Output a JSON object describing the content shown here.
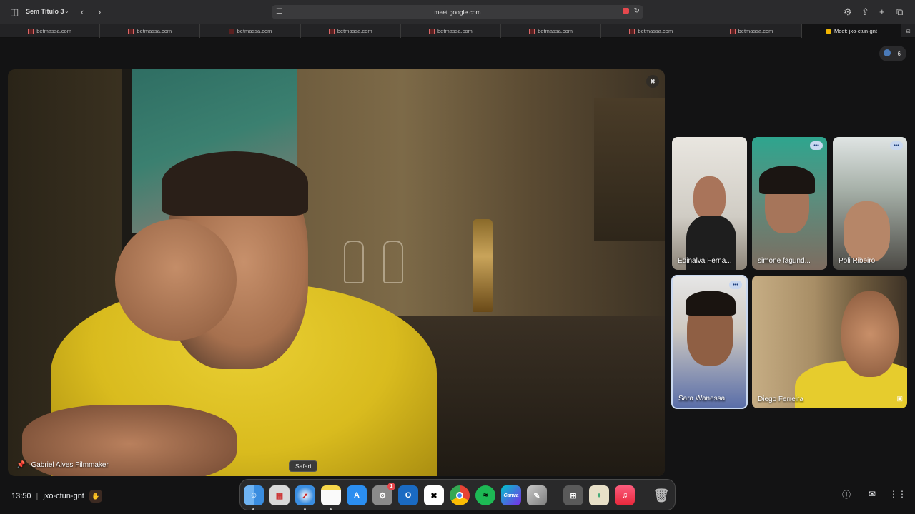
{
  "browser": {
    "window_title": "Sem Título 3",
    "url": "meet.google.com"
  },
  "tabs": [
    {
      "label": "betmassa.com",
      "active": false
    },
    {
      "label": "betmassa.com",
      "active": false
    },
    {
      "label": "betmassa.com",
      "active": false
    },
    {
      "label": "betmassa.com",
      "active": false
    },
    {
      "label": "betmassa.com",
      "active": false
    },
    {
      "label": "betmassa.com",
      "active": false
    },
    {
      "label": "betmassa.com",
      "active": false
    },
    {
      "label": "betmassa.com",
      "active": false
    },
    {
      "label": "Meet: jxo-ctun-gnt",
      "active": true
    }
  ],
  "meet": {
    "participant_count": "6",
    "main_speaker": "Gabriel Alves Filmmaker",
    "tiles": [
      {
        "name": "Edinalva Ferna...",
        "speaking": false
      },
      {
        "name": "simone fagund...",
        "speaking": true
      },
      {
        "name": "Poli Ribeiro",
        "speaking": true
      },
      {
        "name": "Sara Wanessa",
        "speaking": true
      },
      {
        "name": "Diego Ferreira",
        "speaking": false
      }
    ],
    "time": "13:50",
    "meeting_code": "jxo-ctun-gnt"
  },
  "dock": {
    "tooltip": "Safari",
    "canva_label": "Canva",
    "settings_badge": "1",
    "apps": [
      "Finder",
      "Launchpad",
      "Safari",
      "Notes",
      "App Store",
      "System Settings",
      "Outlook",
      "CapCut",
      "Chrome",
      "Spotify",
      "Canva",
      "Preview",
      "Calculator",
      "Keka",
      "Music",
      "Trash"
    ]
  },
  "colors": {
    "meet_bg": "#131314",
    "speaking_indicator": "#c9d8f0",
    "camera_active": "#e5484d"
  }
}
